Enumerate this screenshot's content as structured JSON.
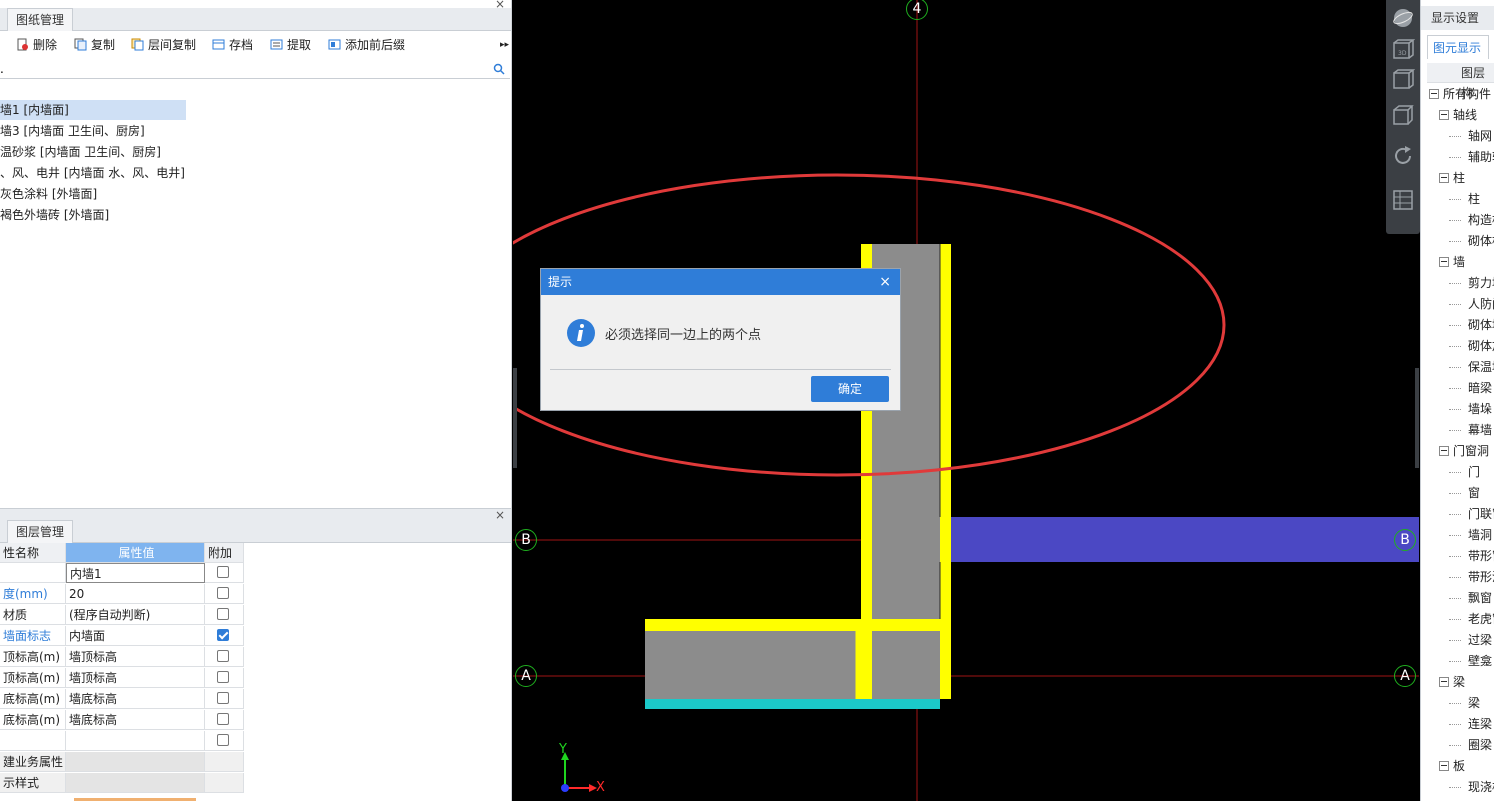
{
  "left_panel": {
    "top_tab": "图纸管理",
    "toolbar": [
      "删除",
      "复制",
      "层间复制",
      "存档",
      "提取",
      "添加前后缀"
    ],
    "search_value": ".",
    "tree_items": [
      {
        "label": "墙1 [内墙面]",
        "selected": true
      },
      {
        "label": "墙3 [内墙面 卫生间、厨房]",
        "selected": false
      },
      {
        "label": "温砂浆 [内墙面 卫生间、厨房]",
        "selected": false
      },
      {
        "label": "、风、电井 [内墙面 水、风、电井]",
        "selected": false
      },
      {
        "label": "灰色涂料 [外墙面]",
        "selected": false
      },
      {
        "label": "褐色外墙砖 [外墙面]",
        "selected": false
      }
    ],
    "bottom_tab": "图层管理",
    "grid_headers": [
      "性名称",
      "属性值",
      "附加"
    ],
    "grid_rows": [
      {
        "name": "",
        "value": "内墙1",
        "check": false,
        "has_check": true,
        "name_blue": false
      },
      {
        "name": "度(mm)",
        "value": "20",
        "check": false,
        "has_check": true,
        "name_blue": true
      },
      {
        "name": "材质",
        "value": "(程序自动判断)",
        "check": false,
        "has_check": true,
        "name_blue": false
      },
      {
        "name": "墙面标志",
        "value": "内墙面",
        "check": true,
        "has_check": true,
        "name_blue": true
      },
      {
        "name": "顶标高(m)",
        "value": "墙顶标高",
        "check": false,
        "has_check": true,
        "name_blue": false
      },
      {
        "name": "顶标高(m)",
        "value": "墙顶标高",
        "check": false,
        "has_check": true,
        "name_blue": false
      },
      {
        "name": "底标高(m)",
        "value": "墙底标高",
        "check": false,
        "has_check": true,
        "name_blue": false
      },
      {
        "name": "底标高(m)",
        "value": "墙底标高",
        "check": false,
        "has_check": true,
        "name_blue": false
      },
      {
        "name": "",
        "value": "",
        "check": false,
        "has_check": true,
        "name_blue": false
      },
      {
        "name": "建业务属性",
        "value": "",
        "check": false,
        "has_check": false,
        "name_blue": false
      },
      {
        "name": "示样式",
        "value": "",
        "check": false,
        "has_check": false,
        "name_blue": false
      }
    ]
  },
  "canvas": {
    "axis_labels": {
      "top": "4",
      "b_left": "B",
      "b_right": "B",
      "a_left": "A",
      "a_right": "A"
    },
    "coord_x": "X",
    "coord_y": "Y"
  },
  "dialog": {
    "title": "提示",
    "close": "×",
    "message": "必须选择同一边上的两个点",
    "ok": "确定"
  },
  "right_panel": {
    "title": "显示设置",
    "tab": "图元显示",
    "header": "图层构",
    "tree": [
      {
        "label": "所有构件",
        "level": 0,
        "group": true
      },
      {
        "label": "轴线",
        "level": 1,
        "group": true
      },
      {
        "label": "轴网",
        "level": 2,
        "group": false
      },
      {
        "label": "辅助轴",
        "level": 2,
        "group": false
      },
      {
        "label": "柱",
        "level": 1,
        "group": true
      },
      {
        "label": "柱",
        "level": 2,
        "group": false
      },
      {
        "label": "构造柱",
        "level": 2,
        "group": false
      },
      {
        "label": "砌体柱",
        "level": 2,
        "group": false
      },
      {
        "label": "墙",
        "level": 1,
        "group": true
      },
      {
        "label": "剪力墙",
        "level": 2,
        "group": false
      },
      {
        "label": "人防门",
        "level": 2,
        "group": false
      },
      {
        "label": "砌体墙",
        "level": 2,
        "group": false
      },
      {
        "label": "砌体加",
        "level": 2,
        "group": false
      },
      {
        "label": "保温墙",
        "level": 2,
        "group": false
      },
      {
        "label": "暗梁",
        "level": 2,
        "group": false
      },
      {
        "label": "墙垛",
        "level": 2,
        "group": false
      },
      {
        "label": "幕墙",
        "level": 2,
        "group": false
      },
      {
        "label": "门窗洞",
        "level": 1,
        "group": true
      },
      {
        "label": "门",
        "level": 2,
        "group": false
      },
      {
        "label": "窗",
        "level": 2,
        "group": false
      },
      {
        "label": "门联窗",
        "level": 2,
        "group": false
      },
      {
        "label": "墙洞",
        "level": 2,
        "group": false
      },
      {
        "label": "带形窗",
        "level": 2,
        "group": false
      },
      {
        "label": "带形洞",
        "level": 2,
        "group": false
      },
      {
        "label": "飘窗",
        "level": 2,
        "group": false
      },
      {
        "label": "老虎窗",
        "level": 2,
        "group": false
      },
      {
        "label": "过梁",
        "level": 2,
        "group": false
      },
      {
        "label": "壁龛",
        "level": 2,
        "group": false
      },
      {
        "label": "梁",
        "level": 1,
        "group": true
      },
      {
        "label": "梁",
        "level": 2,
        "group": false
      },
      {
        "label": "连梁",
        "level": 2,
        "group": false
      },
      {
        "label": "圈梁",
        "level": 2,
        "group": false
      },
      {
        "label": "板",
        "level": 1,
        "group": true
      },
      {
        "label": "现浇板",
        "level": 2,
        "group": false
      }
    ]
  },
  "colors": {
    "accent": "#2f7dd8",
    "wall_fill": "#8c8c8c",
    "wall_edge": "#ffff00",
    "beam": "#4b48c4",
    "cyan_edge": "#1bc9c9",
    "annotation": "#e03a3a"
  },
  "icons": [
    "delete-icon",
    "copy-icon",
    "floor-copy-icon",
    "archive-icon",
    "extract-icon",
    "prefix-icon",
    "search-icon",
    "info-icon",
    "close-icon",
    "sphere-icon",
    "3d-view-icon",
    "cube-icon",
    "rotate-icon",
    "grid-icon"
  ]
}
